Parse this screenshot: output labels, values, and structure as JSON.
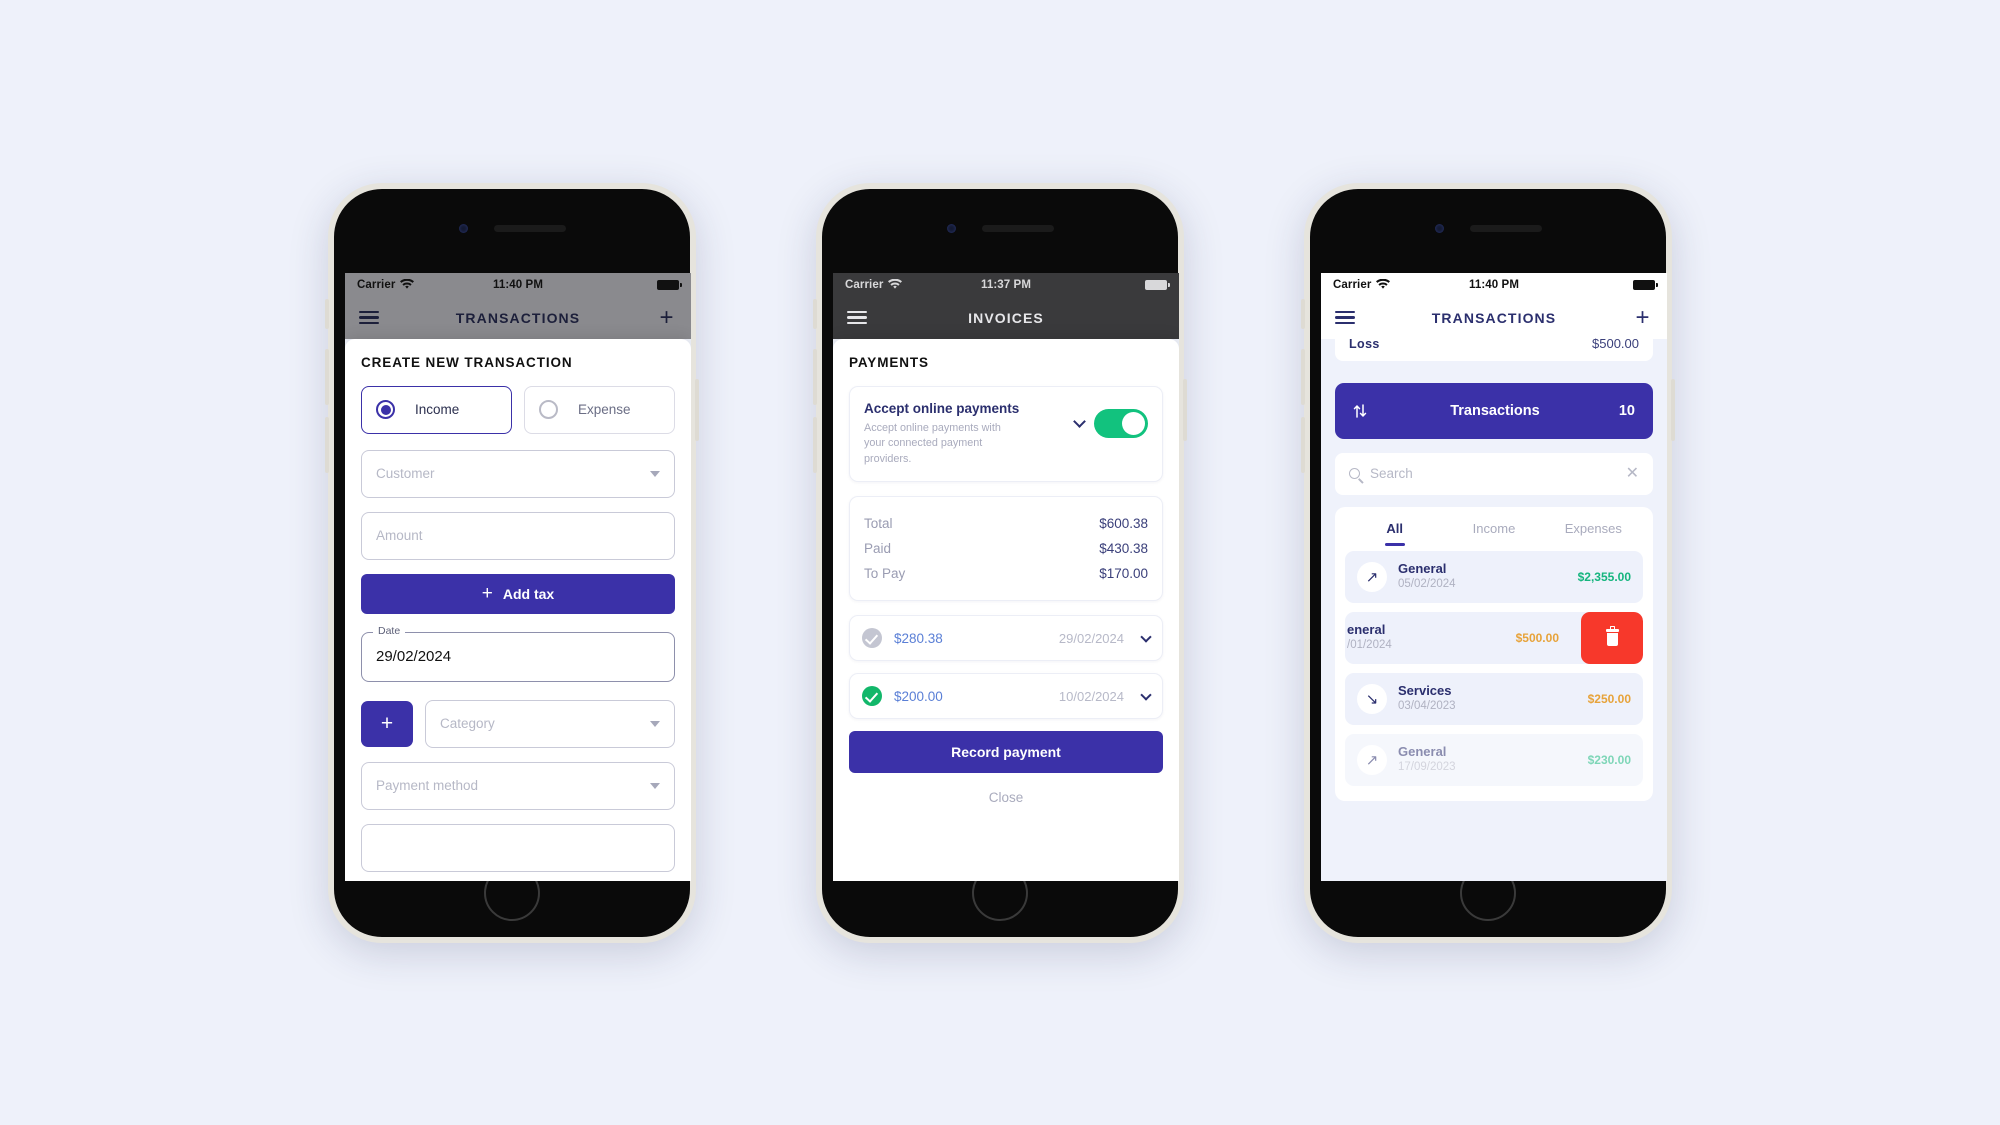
{
  "phone1": {
    "status": {
      "carrier": "Carrier",
      "wifi_icon": "wifi-icon",
      "time": "11:40 PM",
      "battery_icon": "battery-icon"
    },
    "nav": {
      "menu_icon": "hamburger-menu-icon",
      "title": "TRANSACTIONS",
      "add_icon": "plus-icon"
    },
    "sheet_title": "CREATE NEW TRANSACTION",
    "type_options": [
      {
        "label": "Income",
        "selected": true
      },
      {
        "label": "Expense",
        "selected": false
      }
    ],
    "fields": {
      "customer_placeholder": "Customer",
      "amount_placeholder": "Amount",
      "add_tax_label": "Add tax",
      "date_legend": "Date",
      "date_value": "29/02/2024",
      "add_category_icon": "plus-icon",
      "category_placeholder": "Category",
      "payment_method_placeholder": "Payment method"
    }
  },
  "phone2": {
    "status": {
      "carrier": "Carrier",
      "wifi_icon": "wifi-icon",
      "time": "11:37 PM",
      "battery_icon": "battery-icon"
    },
    "nav": {
      "menu_icon": "hamburger-menu-icon",
      "title": "INVOICES"
    },
    "sheet_title": "PAYMENTS",
    "accept": {
      "title": "Accept online payments",
      "description": "Accept online payments with your connected payment providers.",
      "expand_icon": "chevron-down-icon",
      "toggle_on": true,
      "toggle_color": "#12c27e"
    },
    "totals": [
      {
        "label": "Total",
        "value": "$600.38"
      },
      {
        "label": "Paid",
        "value": "$430.38"
      },
      {
        "label": "To Pay",
        "value": "$170.00"
      }
    ],
    "payments": [
      {
        "status_icon": "check-circle-icon",
        "status": "pending",
        "amount": "$280.38",
        "date": "29/02/2024",
        "expand_icon": "chevron-down-icon"
      },
      {
        "status_icon": "check-circle-icon",
        "status": "paid",
        "amount": "$200.00",
        "date": "10/02/2024",
        "expand_icon": "chevron-down-icon"
      }
    ],
    "record_label": "Record payment",
    "close_label": "Close"
  },
  "phone3": {
    "status": {
      "carrier": "Carrier",
      "wifi_icon": "wifi-icon",
      "time": "11:40 PM",
      "battery_icon": "battery-icon"
    },
    "nav": {
      "menu_icon": "hamburger-menu-icon",
      "title": "TRANSACTIONS",
      "add_icon": "plus-icon"
    },
    "loss": {
      "label": "Loss",
      "value": "$500.00"
    },
    "transactions_bar": {
      "sort_icon": "sort-updown-icon",
      "title": "Transactions",
      "count": "10"
    },
    "search": {
      "icon": "search-icon",
      "placeholder": "Search",
      "clear_icon": "close-icon"
    },
    "tabs": [
      {
        "label": "All",
        "active": true
      },
      {
        "label": "Income",
        "active": false
      },
      {
        "label": "Expenses",
        "active": false
      }
    ],
    "rows": [
      {
        "direction_icon": "arrow-up-right-icon",
        "name": "General",
        "date": "05/02/2024",
        "amount": "$2,355.00",
        "amount_kind": "income",
        "swiped": false
      },
      {
        "direction_icon": "arrow-up-right-icon",
        "name": "eneral",
        "date": "/01/2024",
        "amount": "$500.00",
        "amount_kind": "expense",
        "swiped": true,
        "delete_icon": "trash-icon"
      },
      {
        "direction_icon": "arrow-down-right-icon",
        "name": "Services",
        "date": "03/04/2023",
        "amount": "$250.00",
        "amount_kind": "expense",
        "swiped": false
      },
      {
        "direction_icon": "arrow-up-right-icon",
        "name": "General",
        "date": "17/09/2023",
        "amount": "$230.00",
        "amount_kind": "income",
        "swiped": false
      }
    ]
  },
  "colors": {
    "brand": "#3b31a8",
    "page_bg": "#eef1fa",
    "income_green": "#15b57e",
    "expense_orange": "#e7a33a",
    "delete_red": "#f7382b",
    "toggle_green": "#12c27e"
  }
}
